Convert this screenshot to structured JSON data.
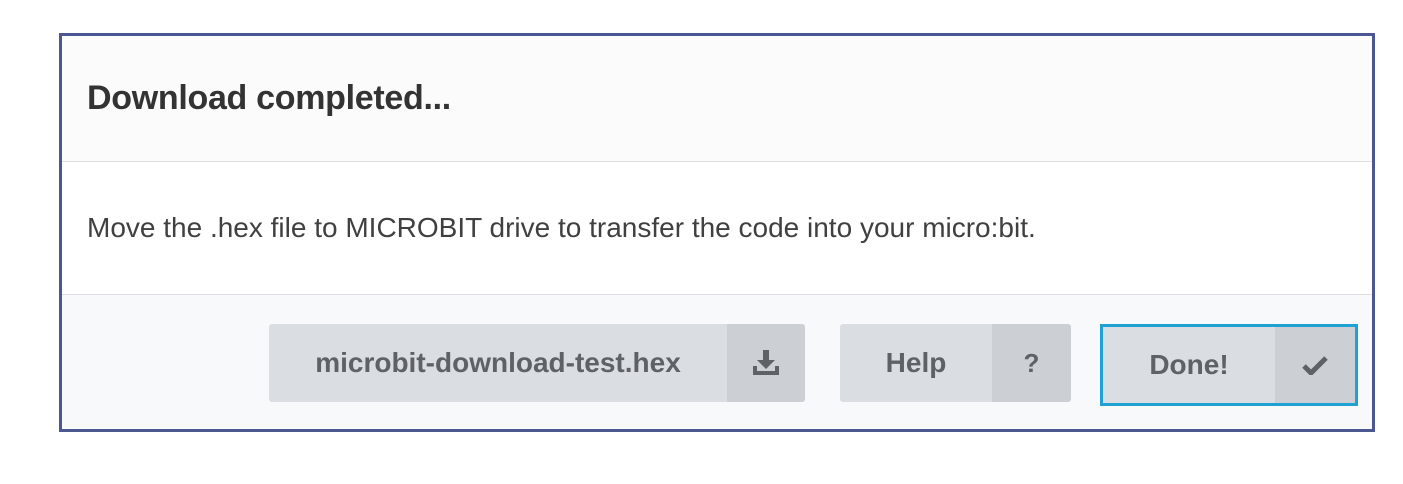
{
  "dialog": {
    "title": "Download completed...",
    "message": "Move the .hex file to MICROBIT drive to transfer the code into your micro:bit."
  },
  "buttons": {
    "download": {
      "label": "microbit-download-test.hex",
      "icon": "download-icon"
    },
    "help": {
      "label": "Help",
      "icon_text": "?"
    },
    "done": {
      "label": "Done!",
      "icon": "checkmark-icon"
    }
  },
  "colors": {
    "dialog_border": "#4b5790",
    "focus_ring": "#1fa1d4",
    "button_bg": "#dadde1",
    "button_icon_bg": "#ccd0d5",
    "button_text": "#5e6166"
  }
}
